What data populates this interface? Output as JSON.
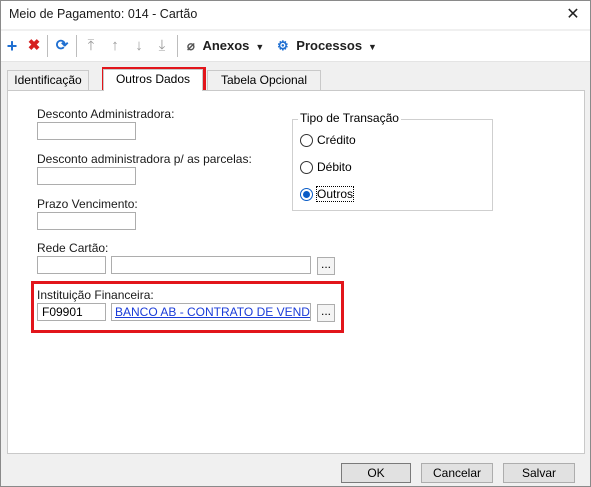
{
  "window": {
    "title": "Meio de Pagamento: 014 - Cartão",
    "close_glyph": "✕"
  },
  "toolbar": {
    "add_glyph": "+",
    "delete_glyph": "✖",
    "refresh_glyph": "⟳",
    "first_glyph": "⤒",
    "prev_glyph": "↑",
    "next_glyph": "↓",
    "last_glyph": "⤓",
    "attachments_glyph": "⌀",
    "attachments_label": "Anexos",
    "processes_glyph": "⚙",
    "processes_label": "Processos",
    "caret": "▼"
  },
  "tabs": [
    {
      "label": "Identificação"
    },
    {
      "label": "Outros Dados"
    },
    {
      "label": "Tabela Opcional"
    }
  ],
  "form": {
    "desconto_admin_label": "Desconto Administradora:",
    "desconto_admin_value": "",
    "desconto_parcelas_label": "Desconto administradora p/ as parcelas:",
    "desconto_parcelas_value": "",
    "prazo_label": "Prazo Vencimento:",
    "prazo_value": "",
    "rede_label": "Rede Cartão:",
    "rede_code": "",
    "rede_desc": "",
    "instituicao_label": "Instituição Financeira:",
    "instituicao_code": "F09901",
    "instituicao_desc": "BANCO AB -  CONTRATO DE VENDOR",
    "lookup_glyph": "..."
  },
  "tipo_transacao": {
    "title": "Tipo de Transação",
    "options": [
      {
        "label": "Crédito"
      },
      {
        "label": "Débito"
      },
      {
        "label": "Outros"
      }
    ],
    "selected": "Outros"
  },
  "footer": {
    "ok": "OK",
    "cancel": "Cancelar",
    "save": "Salvar"
  },
  "colors": {
    "highlight": "#e2151b",
    "accent": "#0a5cc7",
    "add_icon": "#1f6fd1",
    "delete_icon": "#d62020",
    "link": "#1a3bd8"
  }
}
